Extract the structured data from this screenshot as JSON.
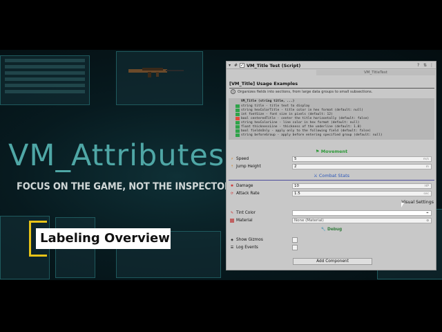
{
  "video": {
    "title": "VM_Attributes",
    "subtitle": "FOCUS ON THE GAME, NOT THE INSPECTOR",
    "badge": "Labeling Overview"
  },
  "colors": {
    "accent_teal": "#4fa7a6",
    "badge_yellow": "#e8c418",
    "group_movement": "#2f9a3a",
    "group_combat": "#2a55b8"
  },
  "inspector": {
    "component_title": "VM_Title Test (Script)",
    "script_field": "VM_TitleTest",
    "section_title": "[VM_Title] Usage Examples",
    "help_text": "Organizes fields into sections, from large data groups to small subsections.",
    "code_lines": [
      "VM_Title (string title, ...)",
      "string title - title text to display",
      "string hexColorTitle - title color in hex format (default: null)",
      "int fontSize - font size in pixels (default: 12)",
      "bool centeredTitle - center the title horizontally (default: false)",
      "string hexColorLine - line color in hex format (default: null)",
      "float thicknessLine - thickness of the underline (default: 1.0)",
      "bool fieldsOnly - apply only to the following field (default: false)",
      "string beforeGroup - apply before entering specified group (default: null)"
    ],
    "groups": {
      "movement": "Movement",
      "combat": "Combat Stats",
      "visual": "Visual Settings",
      "debug": "Debug"
    },
    "props": {
      "speed": {
        "label": "Speed",
        "value": "5",
        "unit": "m/s"
      },
      "jump": {
        "label": "Jump Height",
        "value": "2",
        "unit": "m"
      },
      "damage": {
        "label": "Damage",
        "value": "10",
        "unit": "HP"
      },
      "attack_rate": {
        "label": "Attack Rate",
        "value": "1.5",
        "unit": "sec"
      },
      "tint": {
        "label": "Tint Color",
        "value": ""
      },
      "material": {
        "label": "Material",
        "value": "None (Material)"
      },
      "gizmos": {
        "label": "Show Gizmos"
      },
      "log": {
        "label": "Log Events"
      }
    },
    "add_component": "Add Component"
  }
}
